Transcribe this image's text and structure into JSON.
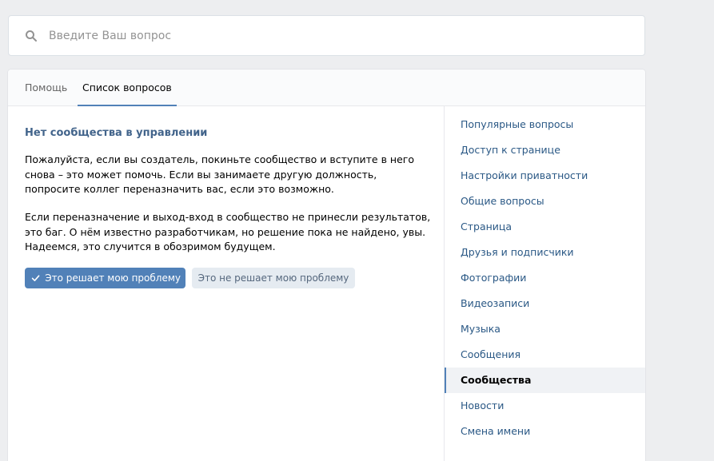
{
  "search": {
    "placeholder": "Введите Ваш вопрос",
    "value": ""
  },
  "tabs": [
    {
      "label": "Помощь",
      "active": false
    },
    {
      "label": "Список вопросов",
      "active": true
    }
  ],
  "article": {
    "title": "Нет сообщества в управлении",
    "paragraphs": [
      "Пожалуйста, если вы создатель, покиньте сообщество и вступите в него снова – это может помочь. Если вы занимаете другую должность, попросите коллег переназначить вас, если это возможно.",
      "Если переназначение и выход-вход в сообщество не принесли результатов, это баг. О нём известно разработчикам, но решение пока не найдено, увы. Надеемся, это случится в обозримом будущем."
    ]
  },
  "feedback": {
    "yes_label": "Это решает мою проблему",
    "no_label": "Это не решает мою проблему"
  },
  "sidebar": {
    "items": [
      {
        "label": "Популярные вопросы",
        "active": false
      },
      {
        "label": "Доступ к странице",
        "active": false
      },
      {
        "label": "Настройки приватности",
        "active": false
      },
      {
        "label": "Общие вопросы",
        "active": false
      },
      {
        "label": "Страница",
        "active": false
      },
      {
        "label": "Друзья и подписчики",
        "active": false
      },
      {
        "label": "Фотографии",
        "active": false
      },
      {
        "label": "Видеозаписи",
        "active": false
      },
      {
        "label": "Музыка",
        "active": false
      },
      {
        "label": "Сообщения",
        "active": false
      },
      {
        "label": "Сообщества",
        "active": true
      },
      {
        "label": "Новости",
        "active": false
      },
      {
        "label": "Смена имени",
        "active": false
      }
    ]
  },
  "colors": {
    "accent": "#5181b8",
    "title": "#42648b",
    "link": "#2a5885",
    "background": "#edeef0"
  },
  "icons": {
    "search": "search-icon",
    "check": "check-icon"
  }
}
